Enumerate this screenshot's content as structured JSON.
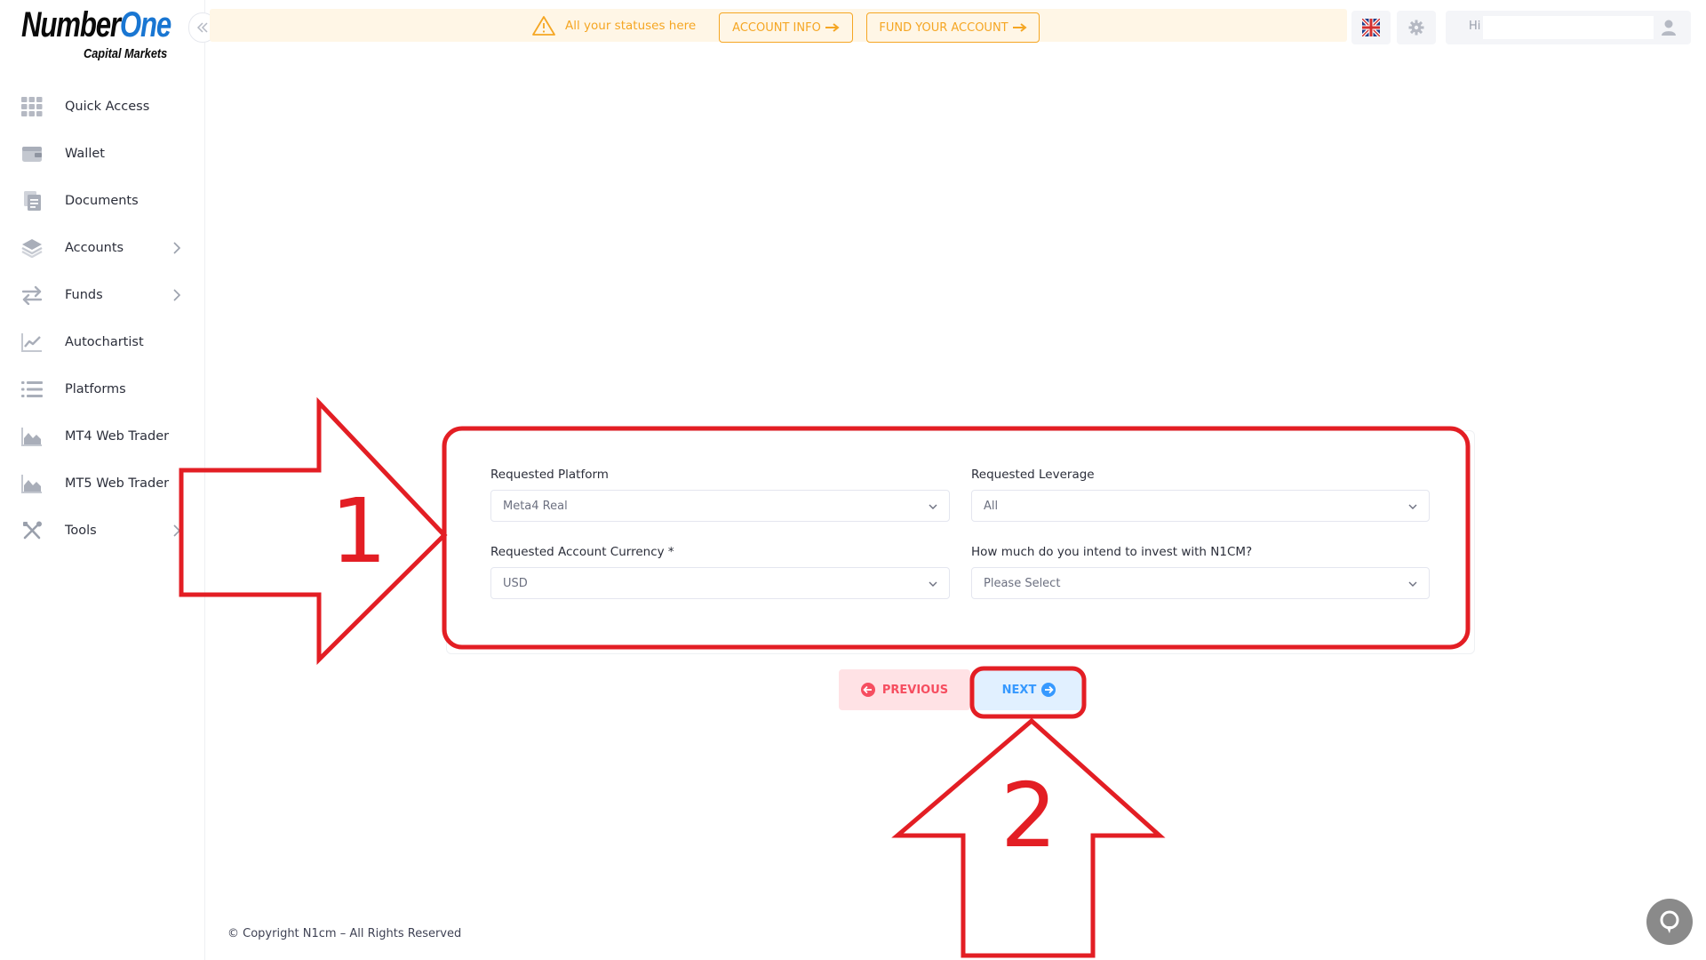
{
  "sidebar": {
    "brand": {
      "line1a": "Number",
      "line1b": "One",
      "line2": "Capital Markets"
    },
    "items": [
      {
        "label": "Quick Access"
      },
      {
        "label": "Wallet"
      },
      {
        "label": "Documents"
      },
      {
        "label": "Accounts"
      },
      {
        "label": "Funds"
      },
      {
        "label": "Autochartist"
      },
      {
        "label": "Platforms"
      },
      {
        "label": "MT4 Web Trader"
      },
      {
        "label": "MT5 Web Trader"
      },
      {
        "label": "Tools"
      }
    ]
  },
  "topbar": {
    "notice": "All your statuses here",
    "account_info": "ACCOUNT INFO",
    "fund_account": "FUND YOUR ACCOUNT",
    "greeting": "Hi"
  },
  "form": {
    "platform": {
      "label": "Requested Platform",
      "value": "Meta4 Real"
    },
    "leverage": {
      "label": "Requested Leverage",
      "value": "All"
    },
    "currency": {
      "label": "Requested Account Currency *",
      "value": "USD"
    },
    "invest": {
      "label": "How much do you intend to invest with N1CM?",
      "value": "Please Select"
    }
  },
  "buttons": {
    "previous": "PREVIOUS",
    "next": "NEXT"
  },
  "annotations": {
    "one": "1",
    "two": "2"
  },
  "footer": "© Copyright N1cm – All Rights Reserved",
  "colors": {
    "accent_orange": "#f5a623",
    "next_blue": "#3699ff",
    "prev_red": "#f64e60",
    "annotation_red": "#e31e24"
  }
}
